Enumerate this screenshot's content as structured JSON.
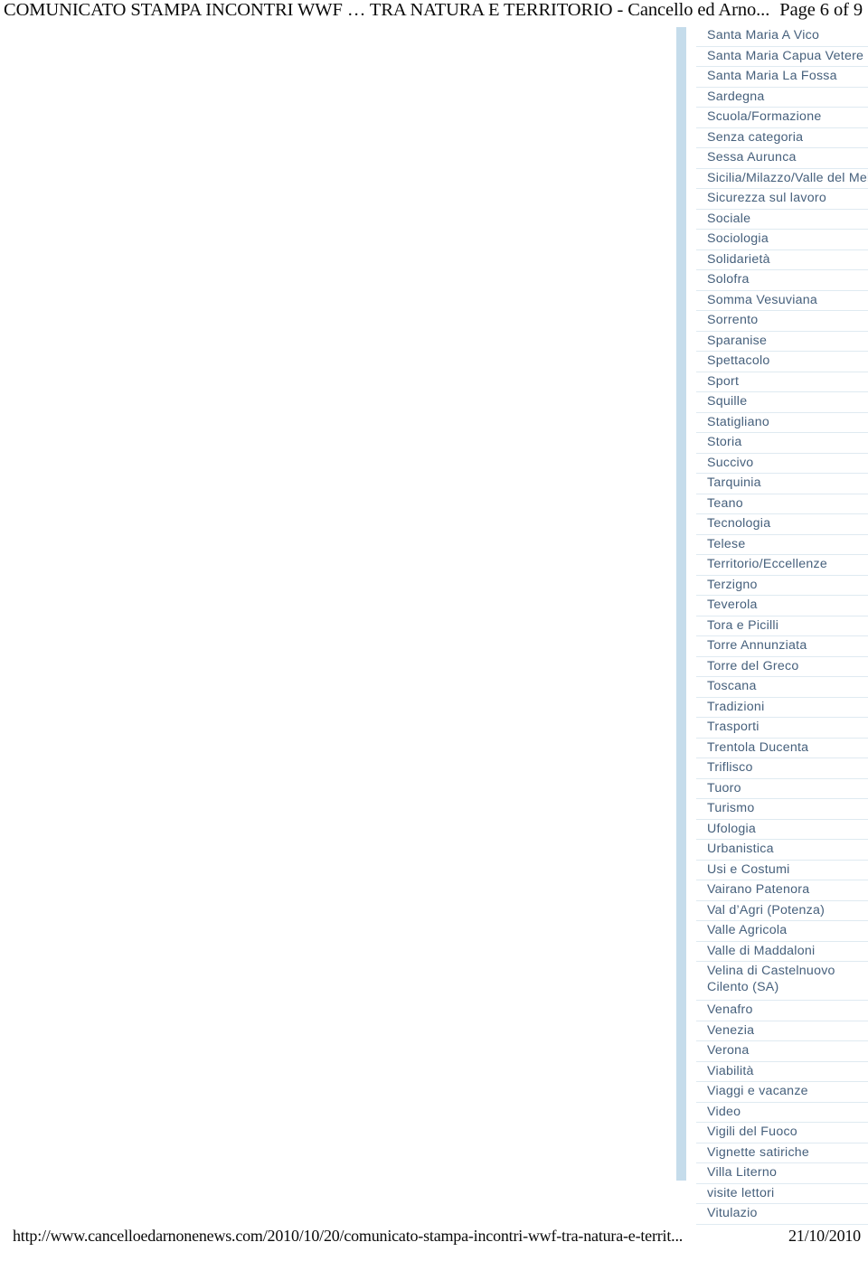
{
  "print_header": {
    "doc_title": "COMUNICATO STAMPA INCONTRI WWF … TRA NATURA E TERRITORIO - Cancello ed Arno...",
    "page_number": "Page 6 of 9"
  },
  "print_footer": {
    "url": "http://www.cancelloedarnonenews.com/2010/10/20/comunicato-stampa-incontri-wwf-tra-natura-e-territ...",
    "date": "21/10/2010"
  },
  "colors": {
    "rail": "#c5dceb",
    "link_text": "#46607c",
    "separator": "#dfeaf1",
    "header_text": "#0a0a0a",
    "page_background": "#ffffff"
  },
  "category_list": {
    "name": "categories-widget",
    "items": [
      {
        "label": "Santa Maria A Vico",
        "wrap": false
      },
      {
        "label": "Santa Maria Capua Vetere",
        "wrap": false
      },
      {
        "label": "Santa Maria La Fossa",
        "wrap": false
      },
      {
        "label": "Sardegna",
        "wrap": false
      },
      {
        "label": "Scuola/Formazione",
        "wrap": false
      },
      {
        "label": "Senza categoria",
        "wrap": false
      },
      {
        "label": "Sessa Aurunca",
        "wrap": false
      },
      {
        "label": "Sicilia/Milazzo/Valle del Mela",
        "wrap": false
      },
      {
        "label": "Sicurezza sul lavoro",
        "wrap": false
      },
      {
        "label": "Sociale",
        "wrap": false
      },
      {
        "label": "Sociologia",
        "wrap": false
      },
      {
        "label": "Solidarietà",
        "wrap": false
      },
      {
        "label": "Solofra",
        "wrap": false
      },
      {
        "label": "Somma Vesuviana",
        "wrap": false
      },
      {
        "label": "Sorrento",
        "wrap": false
      },
      {
        "label": "Sparanise",
        "wrap": false
      },
      {
        "label": "Spettacolo",
        "wrap": false
      },
      {
        "label": "Sport",
        "wrap": false
      },
      {
        "label": "Squille",
        "wrap": false
      },
      {
        "label": "Statigliano",
        "wrap": false
      },
      {
        "label": "Storia",
        "wrap": false
      },
      {
        "label": "Succivo",
        "wrap": false
      },
      {
        "label": "Tarquinia",
        "wrap": false
      },
      {
        "label": "Teano",
        "wrap": false
      },
      {
        "label": "Tecnologia",
        "wrap": false
      },
      {
        "label": "Telese",
        "wrap": false
      },
      {
        "label": "Territorio/Eccellenze",
        "wrap": false
      },
      {
        "label": "Terzigno",
        "wrap": false
      },
      {
        "label": "Teverola",
        "wrap": false
      },
      {
        "label": "Tora e Picilli",
        "wrap": false
      },
      {
        "label": "Torre Annunziata",
        "wrap": false
      },
      {
        "label": "Torre del Greco",
        "wrap": false
      },
      {
        "label": "Toscana",
        "wrap": false
      },
      {
        "label": "Tradizioni",
        "wrap": false
      },
      {
        "label": "Trasporti",
        "wrap": false
      },
      {
        "label": "Trentola Ducenta",
        "wrap": false
      },
      {
        "label": "Triflisco",
        "wrap": false
      },
      {
        "label": "Tuoro",
        "wrap": false
      },
      {
        "label": "Turismo",
        "wrap": false
      },
      {
        "label": "Ufologia",
        "wrap": false
      },
      {
        "label": "Urbanistica",
        "wrap": false
      },
      {
        "label": "Usi e Costumi",
        "wrap": false
      },
      {
        "label": "Vairano Patenora",
        "wrap": false
      },
      {
        "label": "Val d’Agri (Potenza)",
        "wrap": false
      },
      {
        "label": "Valle Agricola",
        "wrap": false
      },
      {
        "label": "Valle di Maddaloni",
        "wrap": false
      },
      {
        "label": "Velina di Castelnuovo Cilento (SA)",
        "wrap": true
      },
      {
        "label": "Venafro",
        "wrap": false
      },
      {
        "label": "Venezia",
        "wrap": false
      },
      {
        "label": "Verona",
        "wrap": false
      },
      {
        "label": "Viabilità",
        "wrap": false
      },
      {
        "label": "Viaggi e vacanze",
        "wrap": false
      },
      {
        "label": "Video",
        "wrap": false
      },
      {
        "label": "Vigili del Fuoco",
        "wrap": false
      },
      {
        "label": "Vignette satiriche",
        "wrap": false
      },
      {
        "label": "Villa Literno",
        "wrap": false
      },
      {
        "label": "visite lettori",
        "wrap": false
      },
      {
        "label": "Vitulazio",
        "wrap": false
      }
    ]
  }
}
